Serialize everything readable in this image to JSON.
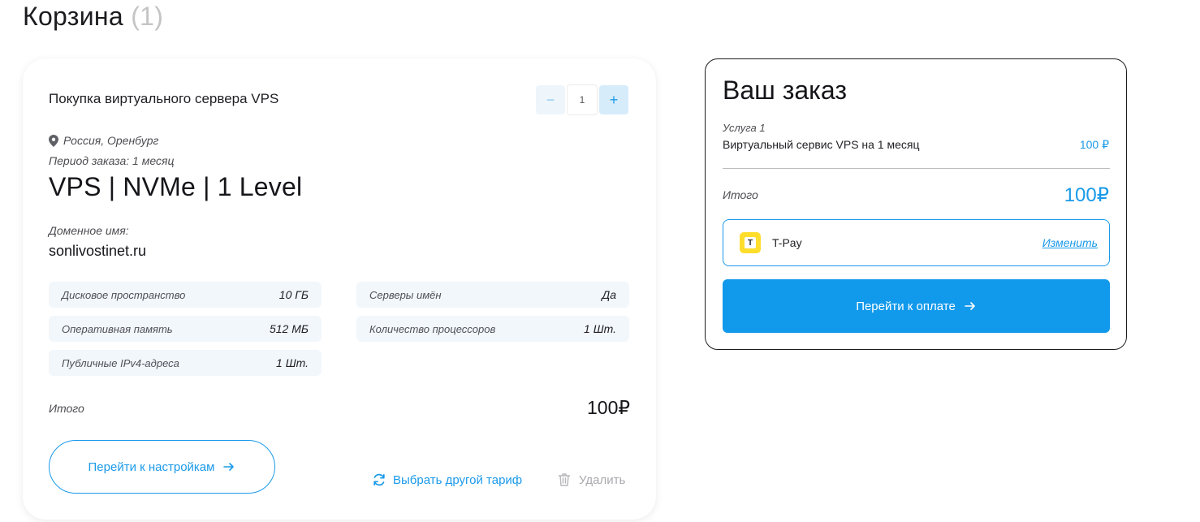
{
  "page": {
    "title": "Корзина",
    "count": "(1)"
  },
  "cart_item": {
    "product_name": "Покупка виртуального сервера VPS",
    "quantity": "1",
    "minus_label": "−",
    "plus_label": "+",
    "location": "Россия, Оренбург",
    "period": "Период заказа: 1 месяц",
    "plan": "VPS | NVMe | 1 Level",
    "domain_label": "Доменное имя:",
    "domain_value": "sonlivostinet.ru",
    "specs": [
      {
        "label": "Дисковое пространство",
        "value": "10 ГБ"
      },
      {
        "label": "Серверы имён",
        "value": "Да"
      },
      {
        "label": "Оперативная память",
        "value": "512 МБ"
      },
      {
        "label": "Количество процессоров",
        "value": "1 Шт."
      },
      {
        "label": "Публичные IPv4-адреса",
        "value": "1 Шт."
      }
    ],
    "total_label": "Итого",
    "total_value": "100₽",
    "settings_button": "Перейти к настройкам",
    "change_tariff": "Выбрать другой тариф",
    "delete": "Удалить"
  },
  "order": {
    "title": "Ваш заказ",
    "service_label": "Услуга 1",
    "service_name": "Виртуальный сервис VPS на 1 месяц",
    "service_price": "100 ₽",
    "total_label": "Итого",
    "total_value": "100₽",
    "payment_method": "T-Pay",
    "payment_logo_letter": "T",
    "payment_change": "Изменить",
    "pay_button": "Перейти к оплате"
  },
  "colors": {
    "accent": "#1a9ae9",
    "tpay_yellow": "#ffdd2d"
  },
  "icons": [
    "location-pin-icon",
    "arrow-right-icon",
    "refresh-icon",
    "trash-icon",
    "tpay-logo-icon"
  ]
}
